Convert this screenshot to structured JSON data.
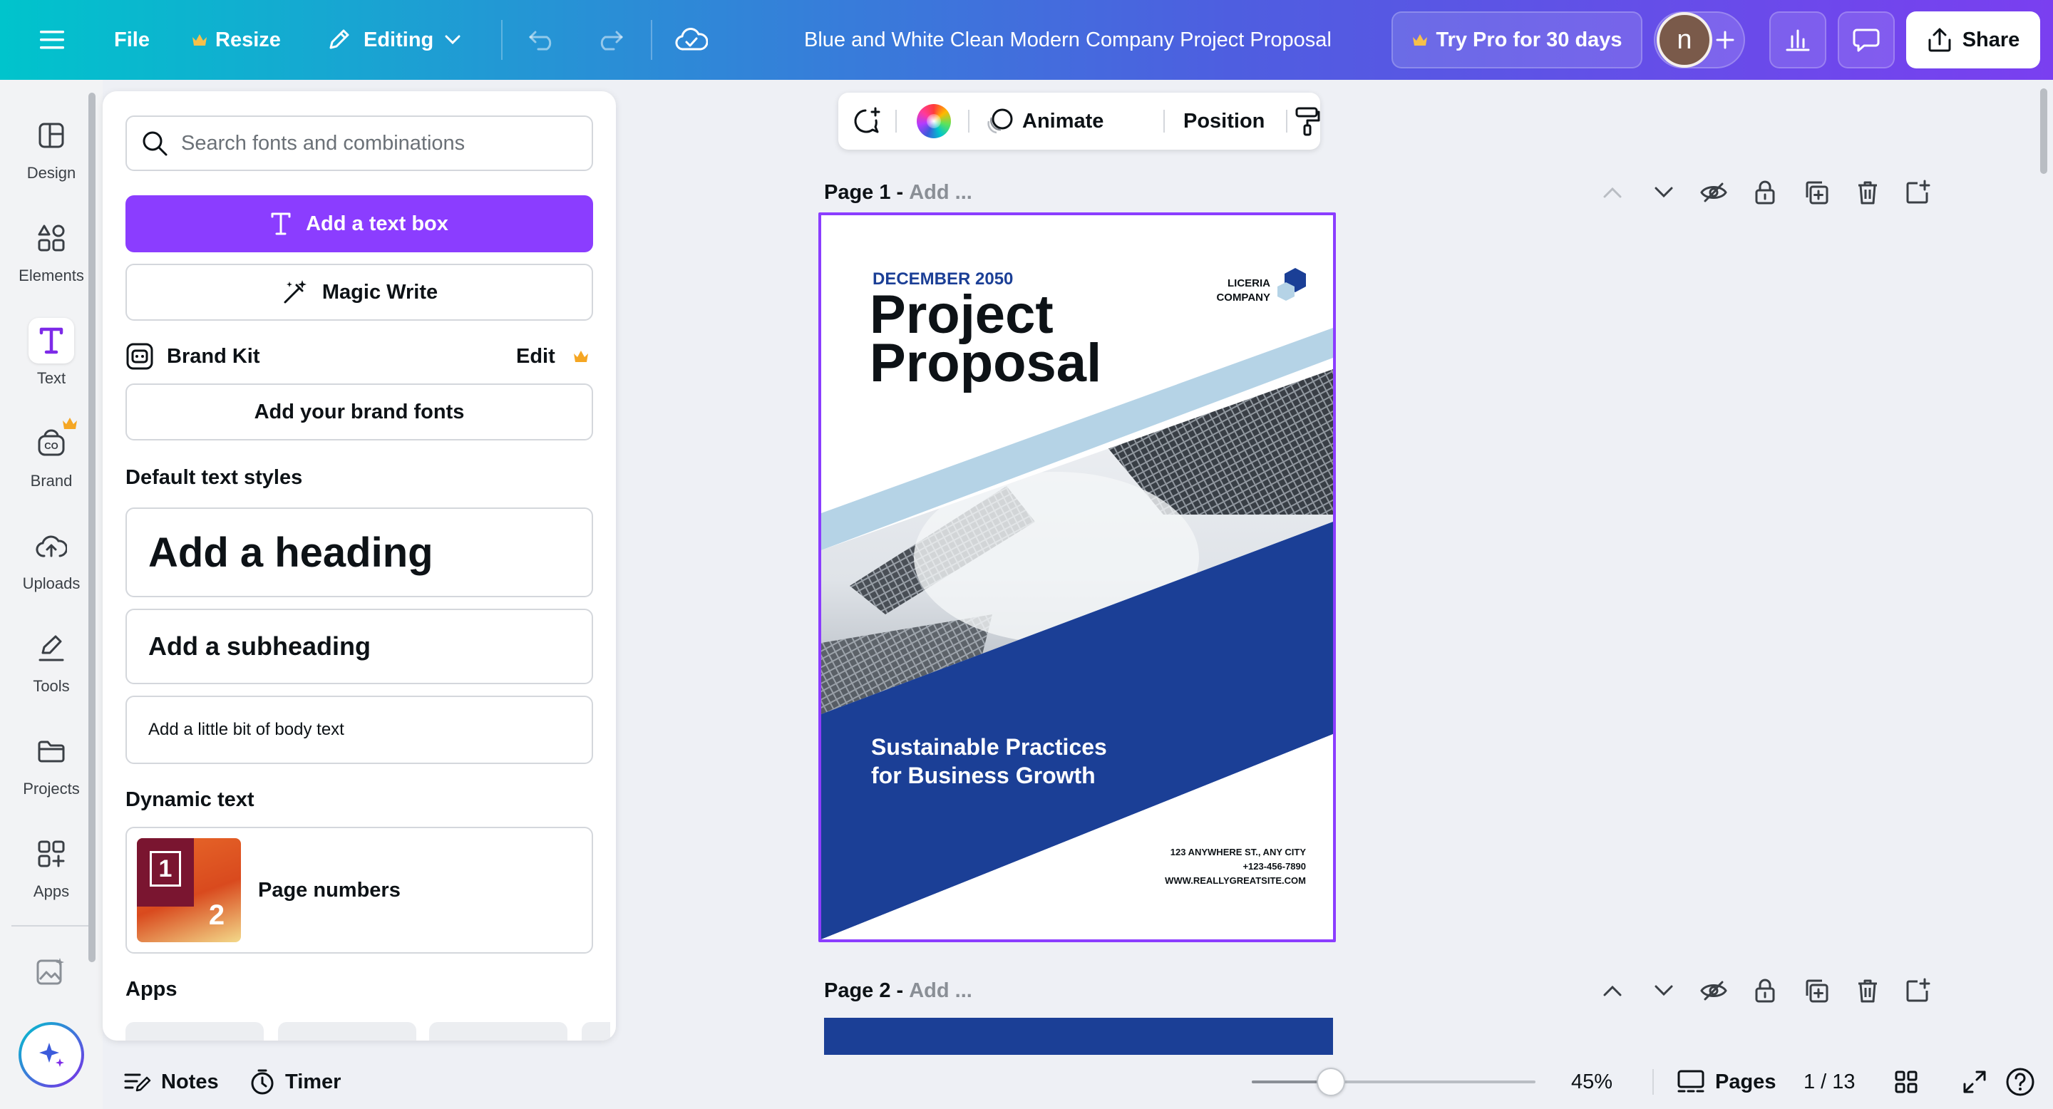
{
  "topbar": {
    "file": "File",
    "resize": "Resize",
    "mode": "Editing",
    "doc_title": "Blue and White Clean Modern Company Project Proposal",
    "try_pro": "Try Pro for 30 days",
    "avatar_letter": "n",
    "share": "Share"
  },
  "rail": {
    "items": [
      {
        "label": "Design",
        "icon": "design-icon"
      },
      {
        "label": "Elements",
        "icon": "elements-icon"
      },
      {
        "label": "Text",
        "icon": "text-icon"
      },
      {
        "label": "Brand",
        "icon": "brand-icon"
      },
      {
        "label": "Uploads",
        "icon": "uploads-icon"
      },
      {
        "label": "Tools",
        "icon": "tools-icon"
      },
      {
        "label": "Projects",
        "icon": "projects-icon"
      },
      {
        "label": "Apps",
        "icon": "apps-icon"
      }
    ],
    "active": "Text"
  },
  "panel": {
    "search_placeholder": "Search fonts and combinations",
    "add_text_box": "Add a text box",
    "magic_write": "Magic Write",
    "brand_kit": "Brand Kit",
    "brand_edit": "Edit",
    "add_brand_fonts": "Add your brand fonts",
    "default_styles_heading": "Default text styles",
    "add_heading": "Add a heading",
    "add_subheading": "Add a subheading",
    "add_body": "Add a little bit of body text",
    "dynamic_heading": "Dynamic text",
    "page_numbers": "Page numbers",
    "thumb_num_1": "1",
    "thumb_num_2": "2",
    "apps_heading": "Apps"
  },
  "float_toolbar": {
    "animate": "Animate",
    "position": "Position"
  },
  "page1": {
    "label": "Page 1 -",
    "title_placeholder": "Add ..."
  },
  "page2": {
    "label": "Page 2 -",
    "title_placeholder": "Add ..."
  },
  "design": {
    "date": "DECEMBER 2050",
    "title_line1": "Project",
    "title_line2": "Proposal",
    "company_line1": "LICERIA",
    "company_line2": "COMPANY",
    "subtitle_line1": "Sustainable Practices",
    "subtitle_line2": "for Business Growth",
    "address": "123 ANYWHERE ST., ANY CITY",
    "phone": "+123-456-7890",
    "website": "WWW.REALLYGREATSITE.COM"
  },
  "bottom": {
    "notes": "Notes",
    "timer": "Timer",
    "zoom": "45%",
    "zoom_level": 0.45,
    "pages": "Pages",
    "page_count": "1 / 13"
  },
  "colors": {
    "accent_purple": "#7d2ae8",
    "design_blue": "#1b3f96",
    "light_blue": "#b5d3e6",
    "crown": "#f5a623"
  }
}
